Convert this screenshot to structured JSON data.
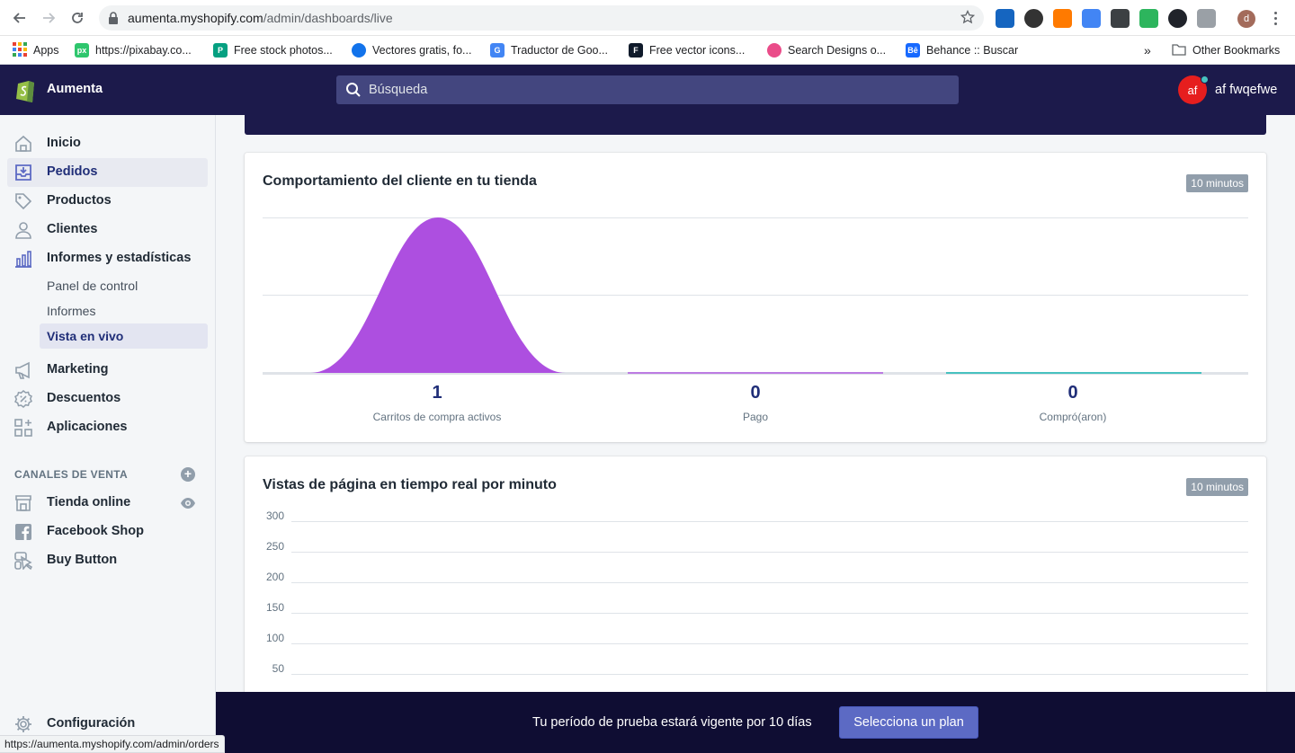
{
  "browser": {
    "url_host": "aumenta.myshopify.com",
    "url_path": "/admin/dashboards/live",
    "status_url": "https://aumenta.myshopify.com/admin/orders",
    "profile_initial": "d",
    "bookmarks": [
      {
        "label": "Apps",
        "icon": "apps-grid-icon"
      },
      {
        "label": "https://pixabay.co...",
        "icon": "pixabay-icon"
      },
      {
        "label": "Free stock photos...",
        "icon": "pexels-icon"
      },
      {
        "label": "Vectores gratis, fo...",
        "icon": "freepik-icon"
      },
      {
        "label": "Traductor de Goo...",
        "icon": "google-translate-icon"
      },
      {
        "label": "Free vector icons...",
        "icon": "flaticon-icon"
      },
      {
        "label": "Search Designs o...",
        "icon": "dribbble-icon"
      },
      {
        "label": "Behance :: Buscar",
        "icon": "behance-icon"
      }
    ],
    "bookmarks_overflow": "»",
    "other_bookmarks": "Other Bookmarks"
  },
  "topbar": {
    "store_name": "Aumenta",
    "search_placeholder": "Búsqueda",
    "user_initials": "af",
    "user_name": "af fwqefwe"
  },
  "sidebar": {
    "items": [
      {
        "label": "Inicio",
        "icon": "home-icon"
      },
      {
        "label": "Pedidos",
        "icon": "orders-icon"
      },
      {
        "label": "Productos",
        "icon": "tag-icon"
      },
      {
        "label": "Clientes",
        "icon": "customer-icon"
      },
      {
        "label": "Informes y estadísticas",
        "icon": "analytics-icon"
      }
    ],
    "sub_items": [
      {
        "label": "Panel de control"
      },
      {
        "label": "Informes"
      },
      {
        "label": "Vista en vivo"
      }
    ],
    "items2": [
      {
        "label": "Marketing",
        "icon": "megaphone-icon"
      },
      {
        "label": "Descuentos",
        "icon": "discount-icon"
      },
      {
        "label": "Aplicaciones",
        "icon": "apps-icon"
      }
    ],
    "sales_channels_title": "CANALES DE VENTA",
    "channels": [
      {
        "label": "Tienda online",
        "icon": "store-icon"
      },
      {
        "label": "Facebook Shop",
        "icon": "facebook-icon"
      },
      {
        "label": "Buy Button",
        "icon": "buy-button-icon"
      }
    ],
    "settings": "Configuración"
  },
  "behavior_card": {
    "title": "Comportamiento del cliente en tu tienda",
    "badge": "10 minutos",
    "stats": [
      {
        "value": "1",
        "label": "Carritos de compra activos"
      },
      {
        "value": "0",
        "label": "Pago"
      },
      {
        "value": "0",
        "label": "Compró(aron)"
      }
    ]
  },
  "pageviews_card": {
    "title": "Vistas de página en tiempo real por minuto",
    "badge": "10 minutos",
    "y_ticks": [
      "300",
      "250",
      "200",
      "150",
      "100",
      "50"
    ]
  },
  "trial": {
    "text": "Tu período de prueba estará vigente por 10 días",
    "button": "Selecciona un plan"
  },
  "colors": {
    "topbar": "#1c1a4b",
    "accent": "#5c6ac4",
    "funnel_purple": "#ad4fe0",
    "teal": "#47c1bf",
    "avatar_red": "#e61e1e"
  }
}
